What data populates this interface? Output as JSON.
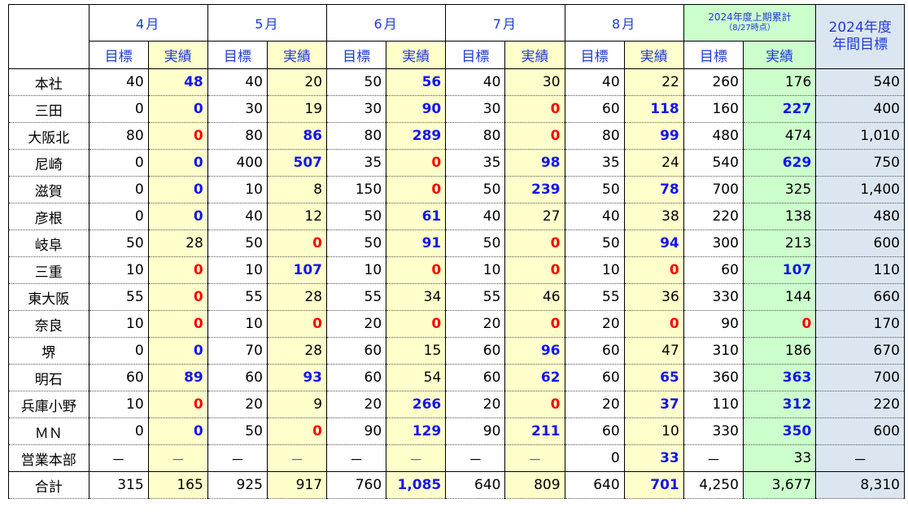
{
  "header": {
    "months": [
      "4月",
      "5月",
      "6月",
      "7月",
      "8月"
    ],
    "target_label": "目標",
    "actual_label": "実績",
    "cumulative_title": "2024年度上期累計",
    "cumulative_note": "（8/27時点）",
    "annual_title_1": "2024年度",
    "annual_title_2": "年間目標"
  },
  "colors": {
    "highlight_over": "#1515ee",
    "highlight_zero": "#ff0000"
  },
  "rows": [
    {
      "name": "本社",
      "cells": [
        [
          "40",
          ""
        ],
        [
          "48",
          "b"
        ],
        [
          "40",
          ""
        ],
        [
          "20",
          ""
        ],
        [
          "50",
          ""
        ],
        [
          "56",
          "b"
        ],
        [
          "40",
          ""
        ],
        [
          "30",
          ""
        ],
        [
          "40",
          ""
        ],
        [
          "22",
          ""
        ],
        [
          "260",
          ""
        ],
        [
          "176",
          ""
        ]
      ],
      "annual": "540"
    },
    {
      "name": "三田",
      "cells": [
        [
          "0",
          ""
        ],
        [
          "0",
          "b"
        ],
        [
          "30",
          ""
        ],
        [
          "19",
          ""
        ],
        [
          "30",
          ""
        ],
        [
          "90",
          "b"
        ],
        [
          "30",
          ""
        ],
        [
          "0",
          "r"
        ],
        [
          "60",
          ""
        ],
        [
          "118",
          "b"
        ],
        [
          "160",
          ""
        ],
        [
          "227",
          "b"
        ]
      ],
      "annual": "400"
    },
    {
      "name": "大阪北",
      "cells": [
        [
          "80",
          ""
        ],
        [
          "0",
          "r"
        ],
        [
          "80",
          ""
        ],
        [
          "86",
          "b"
        ],
        [
          "80",
          ""
        ],
        [
          "289",
          "b"
        ],
        [
          "80",
          ""
        ],
        [
          "0",
          "r"
        ],
        [
          "80",
          ""
        ],
        [
          "99",
          "b"
        ],
        [
          "480",
          ""
        ],
        [
          "474",
          ""
        ]
      ],
      "annual": "1,010"
    },
    {
      "name": "尼崎",
      "cells": [
        [
          "0",
          ""
        ],
        [
          "0",
          "b"
        ],
        [
          "400",
          ""
        ],
        [
          "507",
          "b"
        ],
        [
          "35",
          ""
        ],
        [
          "0",
          "r"
        ],
        [
          "35",
          ""
        ],
        [
          "98",
          "b"
        ],
        [
          "35",
          ""
        ],
        [
          "24",
          ""
        ],
        [
          "540",
          ""
        ],
        [
          "629",
          "b"
        ]
      ],
      "annual": "750"
    },
    {
      "name": "滋賀",
      "cells": [
        [
          "0",
          ""
        ],
        [
          "0",
          "b"
        ],
        [
          "10",
          ""
        ],
        [
          "8",
          ""
        ],
        [
          "150",
          ""
        ],
        [
          "0",
          "r"
        ],
        [
          "50",
          ""
        ],
        [
          "239",
          "b"
        ],
        [
          "50",
          ""
        ],
        [
          "78",
          "b"
        ],
        [
          "700",
          ""
        ],
        [
          "325",
          ""
        ]
      ],
      "annual": "1,400"
    },
    {
      "name": "彦根",
      "cells": [
        [
          "0",
          ""
        ],
        [
          "0",
          "b"
        ],
        [
          "40",
          ""
        ],
        [
          "12",
          ""
        ],
        [
          "50",
          ""
        ],
        [
          "61",
          "b"
        ],
        [
          "40",
          ""
        ],
        [
          "27",
          ""
        ],
        [
          "40",
          ""
        ],
        [
          "38",
          ""
        ],
        [
          "220",
          ""
        ],
        [
          "138",
          ""
        ]
      ],
      "annual": "480"
    },
    {
      "name": "岐阜",
      "cells": [
        [
          "50",
          ""
        ],
        [
          "28",
          ""
        ],
        [
          "50",
          ""
        ],
        [
          "0",
          "r"
        ],
        [
          "50",
          ""
        ],
        [
          "91",
          "b"
        ],
        [
          "50",
          ""
        ],
        [
          "0",
          "r"
        ],
        [
          "50",
          ""
        ],
        [
          "94",
          "b"
        ],
        [
          "300",
          ""
        ],
        [
          "213",
          ""
        ]
      ],
      "annual": "600"
    },
    {
      "name": "三重",
      "cells": [
        [
          "10",
          ""
        ],
        [
          "0",
          "r"
        ],
        [
          "10",
          ""
        ],
        [
          "107",
          "b"
        ],
        [
          "10",
          ""
        ],
        [
          "0",
          "r"
        ],
        [
          "10",
          ""
        ],
        [
          "0",
          "r"
        ],
        [
          "10",
          ""
        ],
        [
          "0",
          "r"
        ],
        [
          "60",
          ""
        ],
        [
          "107",
          "b"
        ]
      ],
      "annual": "110"
    },
    {
      "name": "東大阪",
      "cells": [
        [
          "55",
          ""
        ],
        [
          "0",
          "r"
        ],
        [
          "55",
          ""
        ],
        [
          "28",
          ""
        ],
        [
          "55",
          ""
        ],
        [
          "34",
          ""
        ],
        [
          "55",
          ""
        ],
        [
          "46",
          ""
        ],
        [
          "55",
          ""
        ],
        [
          "36",
          ""
        ],
        [
          "330",
          ""
        ],
        [
          "144",
          ""
        ]
      ],
      "annual": "660"
    },
    {
      "name": "奈良",
      "cells": [
        [
          "10",
          ""
        ],
        [
          "0",
          "r"
        ],
        [
          "10",
          ""
        ],
        [
          "0",
          "r"
        ],
        [
          "20",
          ""
        ],
        [
          "0",
          "r"
        ],
        [
          "20",
          ""
        ],
        [
          "0",
          "r"
        ],
        [
          "20",
          ""
        ],
        [
          "0",
          "r"
        ],
        [
          "90",
          ""
        ],
        [
          "0",
          "r"
        ]
      ],
      "annual": "170"
    },
    {
      "name": "堺",
      "cells": [
        [
          "0",
          ""
        ],
        [
          "0",
          "b"
        ],
        [
          "70",
          ""
        ],
        [
          "28",
          ""
        ],
        [
          "60",
          ""
        ],
        [
          "15",
          ""
        ],
        [
          "60",
          ""
        ],
        [
          "96",
          "b"
        ],
        [
          "60",
          ""
        ],
        [
          "47",
          ""
        ],
        [
          "310",
          ""
        ],
        [
          "186",
          ""
        ]
      ],
      "annual": "670"
    },
    {
      "name": "明石",
      "cells": [
        [
          "60",
          ""
        ],
        [
          "89",
          "b"
        ],
        [
          "60",
          ""
        ],
        [
          "93",
          "b"
        ],
        [
          "60",
          ""
        ],
        [
          "54",
          ""
        ],
        [
          "60",
          ""
        ],
        [
          "62",
          "b"
        ],
        [
          "60",
          ""
        ],
        [
          "65",
          "b"
        ],
        [
          "360",
          ""
        ],
        [
          "363",
          "b"
        ]
      ],
      "annual": "700"
    },
    {
      "name": "兵庫小野",
      "cells": [
        [
          "10",
          ""
        ],
        [
          "0",
          "r"
        ],
        [
          "20",
          ""
        ],
        [
          "9",
          ""
        ],
        [
          "20",
          ""
        ],
        [
          "266",
          "b"
        ],
        [
          "20",
          ""
        ],
        [
          "0",
          "r"
        ],
        [
          "20",
          ""
        ],
        [
          "37",
          "b"
        ],
        [
          "110",
          ""
        ],
        [
          "312",
          "b"
        ]
      ],
      "annual": "220"
    },
    {
      "name": "ＭＮ",
      "cells": [
        [
          "0",
          ""
        ],
        [
          "0",
          "b"
        ],
        [
          "50",
          ""
        ],
        [
          "0",
          "r"
        ],
        [
          "90",
          ""
        ],
        [
          "129",
          "b"
        ],
        [
          "90",
          ""
        ],
        [
          "211",
          "b"
        ],
        [
          "60",
          ""
        ],
        [
          "10",
          ""
        ],
        [
          "330",
          ""
        ],
        [
          "350",
          "b"
        ]
      ],
      "annual": "600"
    },
    {
      "name": "営業本部",
      "cells": [
        [
          "－",
          "d"
        ],
        [
          "－",
          "dB"
        ],
        [
          "－",
          "d"
        ],
        [
          "－",
          "dB"
        ],
        [
          "－",
          "d"
        ],
        [
          "－",
          "dB"
        ],
        [
          "－",
          "d"
        ],
        [
          "－",
          "dB"
        ],
        [
          "0",
          ""
        ],
        [
          "33",
          "b"
        ],
        [
          "－",
          "d"
        ],
        [
          "33",
          ""
        ]
      ],
      "annual": "－"
    },
    {
      "name": "合計",
      "total": true,
      "cells": [
        [
          "315",
          ""
        ],
        [
          "165",
          ""
        ],
        [
          "925",
          ""
        ],
        [
          "917",
          ""
        ],
        [
          "760",
          ""
        ],
        [
          "1,085",
          "b"
        ],
        [
          "640",
          ""
        ],
        [
          "809",
          ""
        ],
        [
          "640",
          ""
        ],
        [
          "701",
          "b"
        ],
        [
          "4,250",
          ""
        ],
        [
          "3,677",
          ""
        ]
      ],
      "annual": "8,310"
    }
  ]
}
